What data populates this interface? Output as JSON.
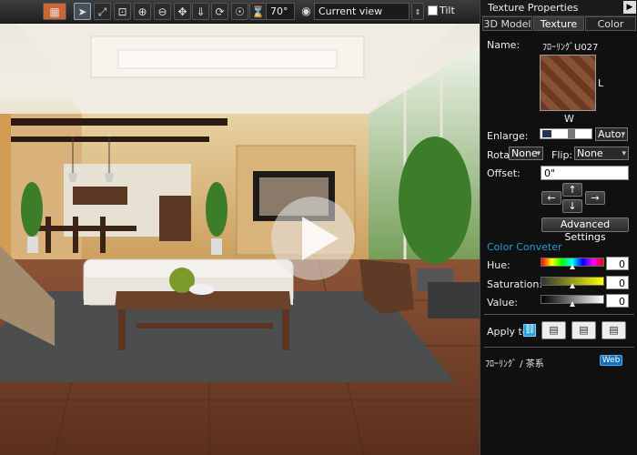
{
  "toolbar": {
    "fov_value": "70°",
    "view_select": "Current view",
    "tilt_label": "Tilt"
  },
  "panel": {
    "title": "Texture Properties",
    "tabs": [
      "3D Model",
      "Texture",
      "Color"
    ],
    "name_label": "Name:",
    "name_value": "ﾌﾛｰﾘﾝｸﾞU027",
    "size_l": "L",
    "size_w": "W",
    "enlarge_label": "Enlarge:",
    "enlarge_mode": "Auto:",
    "rotate_label": "Rotat",
    "rotate_value": "None",
    "flip_label": "Flip:",
    "flip_value": "None",
    "offset_label": "Offset:",
    "offset_value": "0\"",
    "arrows": {
      "up": "↑",
      "left": "←",
      "down": "↓",
      "right": "→"
    },
    "advanced_button": "Advanced Settings",
    "color_section": "Color Conveter",
    "hue_label": "Hue:",
    "hue_value": "0",
    "sat_label": "Saturation:",
    "sat_value": "0",
    "val_label": "Value:",
    "val_value": "0",
    "apply_label": "Apply to:",
    "material_name": "ﾌﾛｰﾘﾝｸﾞ / 茶系",
    "web_button": "Web"
  },
  "colors": {
    "accent": "#1ea0d8",
    "panel_bg": "#101010"
  }
}
